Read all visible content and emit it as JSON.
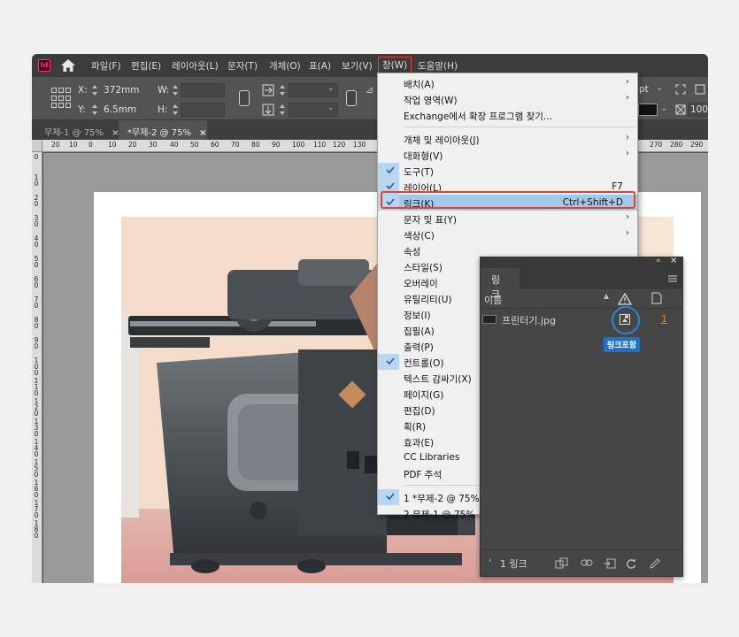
{
  "app": {
    "logo_text": "Id"
  },
  "menubar": {
    "items": [
      "파일(F)",
      "편집(E)",
      "레이아웃(L)",
      "문자(T)",
      "개체(O)",
      "표(A)",
      "보기(V)",
      "창(W)",
      "도움말(H)"
    ]
  },
  "control": {
    "x_label": "X:",
    "x_value": "372mm",
    "y_label": "Y:",
    "y_value": "6.5mm",
    "w_label": "W:",
    "h_label": "H:",
    "pt_value": "pt",
    "percent_value": "100"
  },
  "tabs": [
    {
      "label": "무제-1 @ 75%",
      "close": "×"
    },
    {
      "label": "*무제-2 @ 75%",
      "close": "×"
    }
  ],
  "ruler": {
    "h_ticks": [
      "20",
      "10",
      "0",
      "10",
      "20",
      "30",
      "40",
      "50",
      "60",
      "70",
      "80",
      "90",
      "100",
      "110",
      "120",
      "130",
      "270",
      "280",
      "290"
    ],
    "v_ticks": [
      "0",
      "1 0",
      "2 0",
      "3 0",
      "4 0",
      "5 0",
      "6 0",
      "7 0",
      "8 0",
      "9 0",
      "1 0 0",
      "1 1 0",
      "1 2 0",
      "1 3 0",
      "1 4 0",
      "1 5 0",
      "1 6 0",
      "1 7 0",
      "1 8 0"
    ]
  },
  "window_menu": {
    "items": [
      {
        "label": "배치(A)",
        "submenu": true
      },
      {
        "label": "작업 영역(W)",
        "submenu": true
      },
      {
        "label": "Exchange에서 확장 프로그램 찾기..."
      },
      {
        "sep": true
      },
      {
        "label": "개체 및 레이아웃(J)",
        "submenu": true
      },
      {
        "label": "대화형(V)",
        "submenu": true
      },
      {
        "label": "도구(T)",
        "checked": true
      },
      {
        "label": "레이어(L)",
        "checked": true,
        "shortcut": "F7"
      },
      {
        "label": "링크(K)",
        "checked": true,
        "shortcut": "Ctrl+Shift+D",
        "highlight": true
      },
      {
        "label": "문자 및 표(Y)",
        "submenu": true
      },
      {
        "label": "색상(C)",
        "submenu": true
      },
      {
        "label": "속성"
      },
      {
        "label": "스타일(S)"
      },
      {
        "label": "오버레이"
      },
      {
        "label": "유틸리티(U)"
      },
      {
        "label": "정보(I)"
      },
      {
        "label": "집필(A)"
      },
      {
        "label": "출력(P)"
      },
      {
        "label": "컨트롤(O)",
        "checked": true
      },
      {
        "label": "텍스트 감싸기(X)"
      },
      {
        "label": "페이지(G)"
      },
      {
        "label": "편집(D)"
      },
      {
        "label": "획(R)"
      },
      {
        "label": "효과(E)"
      },
      {
        "label": "CC Libraries"
      },
      {
        "label": "PDF 주석"
      },
      {
        "sep": true
      },
      {
        "label": "1 *무제-2 @ 75%",
        "checked": true
      },
      {
        "label": "2 무제-1 @ 75%"
      }
    ]
  },
  "links_panel": {
    "tab": "링크",
    "column_name": "이름",
    "file_name": "프린터기.jpg",
    "page_num": "1",
    "tooltip": "링크포함",
    "footer_count": "1 링크",
    "collapse_glyph": "«",
    "close_glyph": "×"
  }
}
